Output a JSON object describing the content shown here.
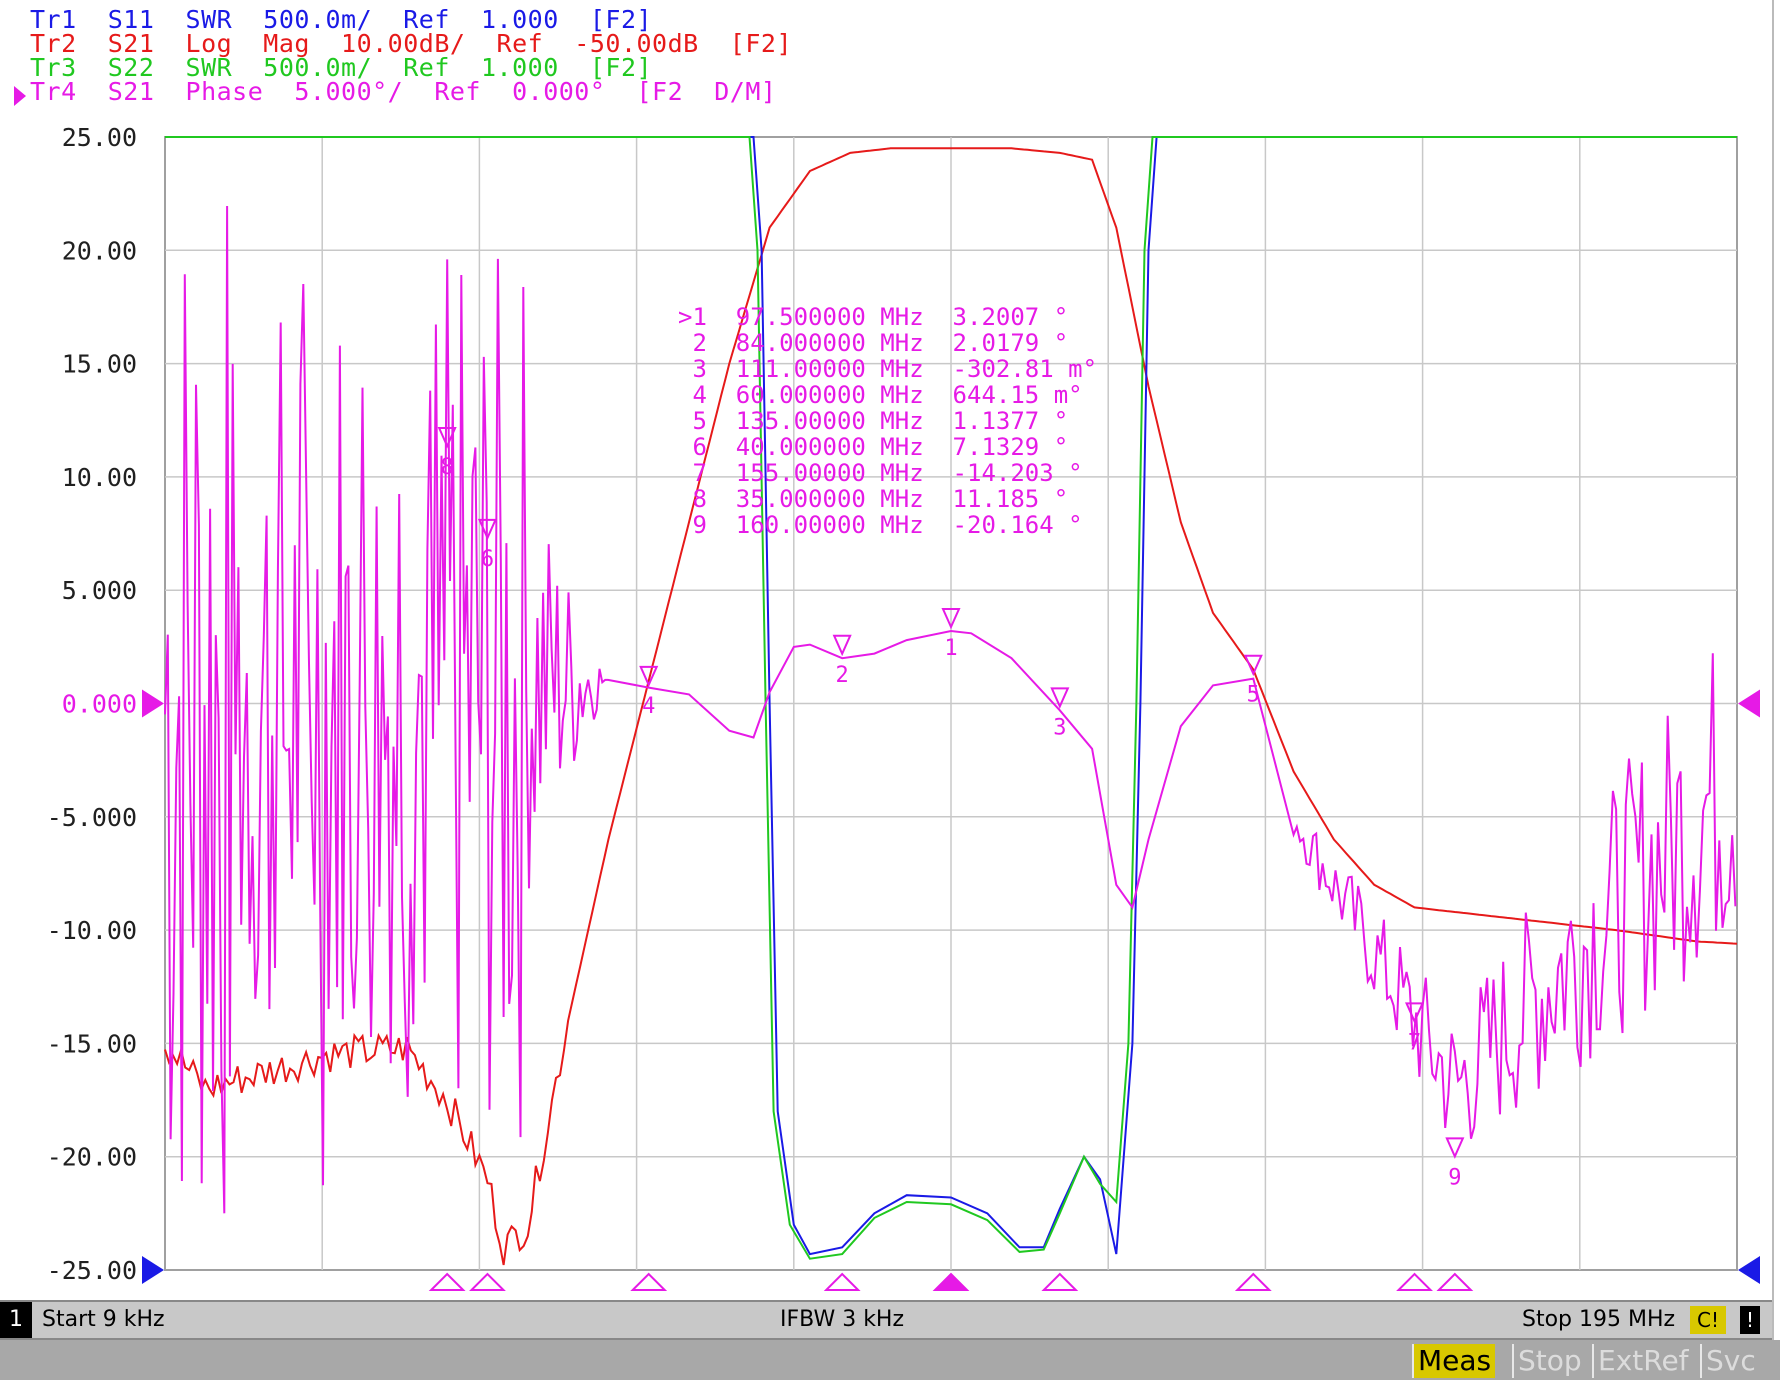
{
  "traces": [
    {
      "label": "Tr1",
      "text": "Tr1  S11  SWR  500.0m/  Ref  1.000  [F2]",
      "color": "#1a1ae6"
    },
    {
      "label": "Tr2",
      "text": "Tr2  S21  Log  Mag  10.00dB/  Ref  -50.00dB  [F2]",
      "color": "#e61a1a"
    },
    {
      "label": "Tr3",
      "text": "Tr3  S22  SWR  500.0m/  Ref  1.000  [F2]",
      "color": "#20c820"
    },
    {
      "label": "Tr4",
      "text": "Tr4  S21  Phase  5.000°/  Ref  0.000°  [F2  D/M]",
      "color": "#e61ae6"
    }
  ],
  "active_trace_label": "Tr4",
  "y_axis_ticks": [
    "25.00",
    "20.00",
    "15.00",
    "10.00",
    "5.000",
    "0.000",
    "-5.000",
    "-10.00",
    "-15.00",
    "-20.00",
    "-25.00"
  ],
  "marker_table": [
    {
      "prefix": ">1",
      "freq": "97.500000 MHz",
      "value": "3.2007 °"
    },
    {
      "prefix": "2",
      "freq": "84.000000 MHz",
      "value": "2.0179 °"
    },
    {
      "prefix": "3",
      "freq": "111.00000 MHz",
      "value": "-302.81 m°"
    },
    {
      "prefix": "4",
      "freq": "60.000000 MHz",
      "value": "644.15 m°"
    },
    {
      "prefix": "5",
      "freq": "135.00000 MHz",
      "value": "1.1377 °"
    },
    {
      "prefix": "6",
      "freq": "40.000000 MHz",
      "value": "7.1329 °"
    },
    {
      "prefix": "7",
      "freq": "155.00000 MHz",
      "value": "-14.203 °"
    },
    {
      "prefix": "8",
      "freq": "35.000000 MHz",
      "value": "11.185 °"
    },
    {
      "prefix": "9",
      "freq": "160.00000 MHz",
      "value": "-20.164 °"
    }
  ],
  "status": {
    "channel": "1",
    "start": "Start 9 kHz",
    "ifbw": "IFBW 3 kHz",
    "stop": "Stop 195 MHz",
    "cal": "C!",
    "warning": "!"
  },
  "softkeys": [
    "Meas",
    "Stop",
    "ExtRef",
    "Svc"
  ],
  "chart_data": {
    "type": "line",
    "x_unit": "MHz",
    "xlim": [
      0.009,
      195
    ],
    "ylim": [
      -25,
      25
    ],
    "grid": true,
    "reference_level": 0,
    "markers": [
      {
        "id": "1",
        "freq_mhz": 97.5,
        "phase_deg": 3.2007
      },
      {
        "id": "2",
        "freq_mhz": 84.0,
        "phase_deg": 2.0179
      },
      {
        "id": "3",
        "freq_mhz": 111.0,
        "phase_deg": -0.30281
      },
      {
        "id": "4",
        "freq_mhz": 60.0,
        "phase_deg": 0.64415
      },
      {
        "id": "5",
        "freq_mhz": 135.0,
        "phase_deg": 1.1377
      },
      {
        "id": "6",
        "freq_mhz": 40.0,
        "phase_deg": 7.1329
      },
      {
        "id": "7",
        "freq_mhz": 155.0,
        "phase_deg": -14.203
      },
      {
        "id": "8",
        "freq_mhz": 35.0,
        "phase_deg": 11.185
      },
      {
        "id": "9",
        "freq_mhz": 160.0,
        "phase_deg": -20.164
      }
    ],
    "series": [
      {
        "name": "Tr2",
        "color": "#e61a1a",
        "points": [
          [
            0,
            -15
          ],
          [
            5,
            -17
          ],
          [
            10,
            -16.5
          ],
          [
            20,
            -15.5
          ],
          [
            30,
            -15.2
          ],
          [
            35,
            -17.5
          ],
          [
            40,
            -21
          ],
          [
            42,
            -24
          ],
          [
            45,
            -23
          ],
          [
            50,
            -14
          ],
          [
            55,
            -6
          ],
          [
            60,
            1
          ],
          [
            65,
            8
          ],
          [
            70,
            15
          ],
          [
            75,
            21
          ],
          [
            80,
            23.5
          ],
          [
            85,
            24.3
          ],
          [
            90,
            24.5
          ],
          [
            97.5,
            24.5
          ],
          [
            105,
            24.5
          ],
          [
            111,
            24.3
          ],
          [
            115,
            24
          ],
          [
            118,
            21
          ],
          [
            122,
            14
          ],
          [
            126,
            8
          ],
          [
            130,
            4
          ],
          [
            135,
            1.5
          ],
          [
            140,
            -3
          ],
          [
            145,
            -6
          ],
          [
            150,
            -8
          ],
          [
            155,
            -9
          ],
          [
            160,
            -9.2
          ],
          [
            170,
            -9.6
          ],
          [
            180,
            -10
          ],
          [
            190,
            -10.5
          ],
          [
            195,
            -10.6
          ]
        ]
      },
      {
        "name": "Tr1",
        "color": "#1a1ae6",
        "points": [
          [
            0,
            25
          ],
          [
            73,
            25
          ],
          [
            74,
            20
          ],
          [
            75,
            0
          ],
          [
            76,
            -18
          ],
          [
            78,
            -23
          ],
          [
            80,
            -24.3
          ],
          [
            84,
            -24
          ],
          [
            88,
            -22.5
          ],
          [
            92,
            -21.7
          ],
          [
            97.5,
            -21.8
          ],
          [
            102,
            -22.5
          ],
          [
            106,
            -24
          ],
          [
            109,
            -24
          ],
          [
            111,
            -22.3
          ],
          [
            114,
            -20
          ],
          [
            116,
            -21
          ],
          [
            118,
            -24.3
          ],
          [
            120,
            -15
          ],
          [
            121,
            0
          ],
          [
            122,
            20
          ],
          [
            123,
            25
          ],
          [
            195,
            25
          ]
        ]
      },
      {
        "name": "Tr3",
        "color": "#20c820",
        "points": [
          [
            0,
            25
          ],
          [
            72.5,
            25
          ],
          [
            73.5,
            20
          ],
          [
            74.5,
            0
          ],
          [
            75.5,
            -18
          ],
          [
            77.5,
            -23
          ],
          [
            80,
            -24.5
          ],
          [
            84,
            -24.3
          ],
          [
            88,
            -22.7
          ],
          [
            92,
            -22
          ],
          [
            97.5,
            -22.1
          ],
          [
            102,
            -22.8
          ],
          [
            106,
            -24.2
          ],
          [
            109,
            -24.1
          ],
          [
            111,
            -22.5
          ],
          [
            114,
            -20
          ],
          [
            116,
            -21.2
          ],
          [
            118,
            -22
          ],
          [
            119.5,
            -15
          ],
          [
            120.5,
            0
          ],
          [
            121.5,
            20
          ],
          [
            122.5,
            25
          ],
          [
            195,
            25
          ]
        ]
      },
      {
        "name": "Tr4",
        "color": "#e61ae6",
        "points": [
          [
            55,
            1
          ],
          [
            60,
            0.7
          ],
          [
            65,
            0.4
          ],
          [
            70,
            -1.2
          ],
          [
            73,
            -1.5
          ],
          [
            75,
            0.5
          ],
          [
            78,
            2.5
          ],
          [
            80,
            2.6
          ],
          [
            84,
            2.0
          ],
          [
            88,
            2.2
          ],
          [
            92,
            2.8
          ],
          [
            97.5,
            3.2
          ],
          [
            100,
            3.1
          ],
          [
            105,
            2
          ],
          [
            111,
            -0.3
          ],
          [
            115,
            -2
          ],
          [
            118,
            -8
          ],
          [
            120,
            -9
          ],
          [
            122,
            -6
          ],
          [
            126,
            -1
          ],
          [
            130,
            0.8
          ],
          [
            135,
            1.1
          ],
          [
            140,
            -1
          ],
          [
            145,
            -5
          ],
          [
            150,
            -9.5
          ],
          [
            155,
            -14
          ],
          [
            160,
            -18
          ],
          [
            165,
            -13
          ],
          [
            170,
            -10
          ],
          [
            175,
            -8
          ],
          [
            180,
            -6
          ],
          [
            185,
            -5
          ],
          [
            190,
            -3
          ],
          [
            195,
            -2
          ]
        ]
      }
    ]
  }
}
